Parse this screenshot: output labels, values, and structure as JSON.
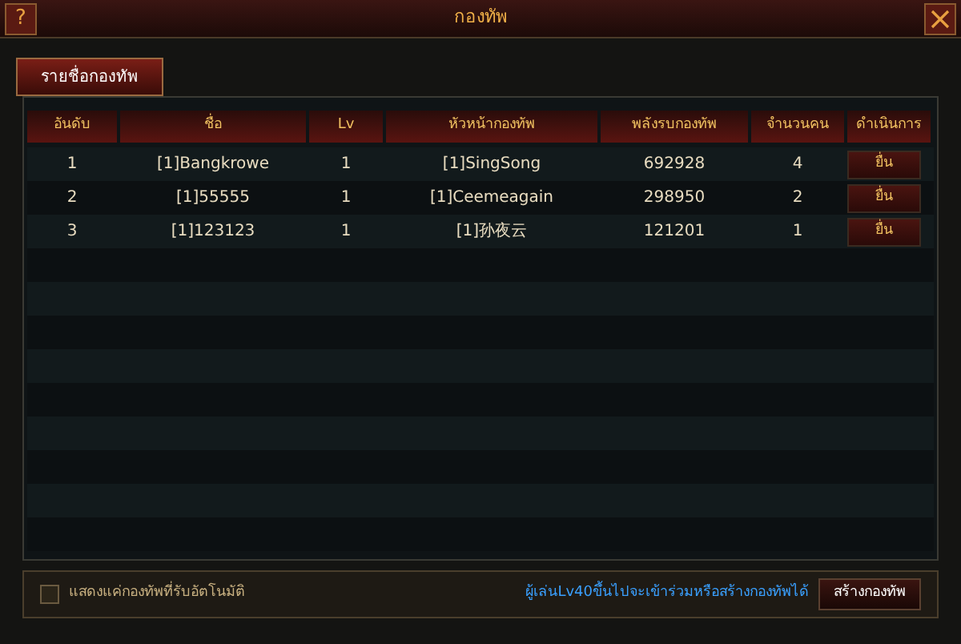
{
  "window": {
    "title": "กองทัพ",
    "help": "?"
  },
  "tabs": [
    {
      "label": "รายชื่อกองทัพ",
      "selected": true
    }
  ],
  "table": {
    "columns": [
      "อันดับ",
      "ชื่อ",
      "Lv",
      "หัวหน้ากองทัพ",
      "พลังรบกองทัพ",
      "จำนวนคน",
      "ดำเนินการ"
    ],
    "rows": [
      {
        "cells": [
          "1",
          "[1]Bangkrowe",
          "1",
          "[1]SingSong",
          "692928",
          "4"
        ],
        "action": "ยื่น"
      },
      {
        "cells": [
          "2",
          "[1]55555",
          "1",
          "[1]Ceemeagain",
          "298950",
          "2"
        ],
        "action": "ยื่น"
      },
      {
        "cells": [
          "3",
          "[1]123123",
          "1",
          "[1]孙夜云",
          "121201",
          "1"
        ],
        "action": "ยื่น"
      }
    ]
  },
  "footer": {
    "auto_accept": {
      "label": "แสดงแค่กองทัพที่รับอัตโนมัติ",
      "checked": false
    },
    "notice": "ผู้เล่นLv40ขึ้นไปจะเข้าร่วมหรือสร้างกองทัพได้",
    "create_button": "สร้างกองทัพ"
  }
}
